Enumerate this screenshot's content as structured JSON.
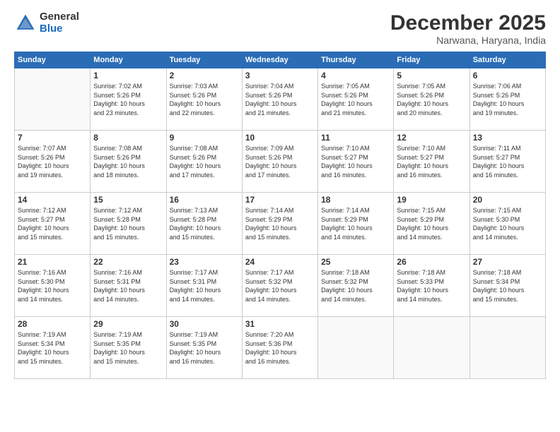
{
  "logo": {
    "general": "General",
    "blue": "Blue"
  },
  "header": {
    "month": "December 2025",
    "location": "Narwana, Haryana, India"
  },
  "weekdays": [
    "Sunday",
    "Monday",
    "Tuesday",
    "Wednesday",
    "Thursday",
    "Friday",
    "Saturday"
  ],
  "weeks": [
    [
      {
        "day": "",
        "info": ""
      },
      {
        "day": "1",
        "info": "Sunrise: 7:02 AM\nSunset: 5:26 PM\nDaylight: 10 hours\nand 23 minutes."
      },
      {
        "day": "2",
        "info": "Sunrise: 7:03 AM\nSunset: 5:26 PM\nDaylight: 10 hours\nand 22 minutes."
      },
      {
        "day": "3",
        "info": "Sunrise: 7:04 AM\nSunset: 5:26 PM\nDaylight: 10 hours\nand 21 minutes."
      },
      {
        "day": "4",
        "info": "Sunrise: 7:05 AM\nSunset: 5:26 PM\nDaylight: 10 hours\nand 21 minutes."
      },
      {
        "day": "5",
        "info": "Sunrise: 7:05 AM\nSunset: 5:26 PM\nDaylight: 10 hours\nand 20 minutes."
      },
      {
        "day": "6",
        "info": "Sunrise: 7:06 AM\nSunset: 5:26 PM\nDaylight: 10 hours\nand 19 minutes."
      }
    ],
    [
      {
        "day": "7",
        "info": "Sunrise: 7:07 AM\nSunset: 5:26 PM\nDaylight: 10 hours\nand 19 minutes."
      },
      {
        "day": "8",
        "info": "Sunrise: 7:08 AM\nSunset: 5:26 PM\nDaylight: 10 hours\nand 18 minutes."
      },
      {
        "day": "9",
        "info": "Sunrise: 7:08 AM\nSunset: 5:26 PM\nDaylight: 10 hours\nand 17 minutes."
      },
      {
        "day": "10",
        "info": "Sunrise: 7:09 AM\nSunset: 5:26 PM\nDaylight: 10 hours\nand 17 minutes."
      },
      {
        "day": "11",
        "info": "Sunrise: 7:10 AM\nSunset: 5:27 PM\nDaylight: 10 hours\nand 16 minutes."
      },
      {
        "day": "12",
        "info": "Sunrise: 7:10 AM\nSunset: 5:27 PM\nDaylight: 10 hours\nand 16 minutes."
      },
      {
        "day": "13",
        "info": "Sunrise: 7:11 AM\nSunset: 5:27 PM\nDaylight: 10 hours\nand 16 minutes."
      }
    ],
    [
      {
        "day": "14",
        "info": "Sunrise: 7:12 AM\nSunset: 5:27 PM\nDaylight: 10 hours\nand 15 minutes."
      },
      {
        "day": "15",
        "info": "Sunrise: 7:12 AM\nSunset: 5:28 PM\nDaylight: 10 hours\nand 15 minutes."
      },
      {
        "day": "16",
        "info": "Sunrise: 7:13 AM\nSunset: 5:28 PM\nDaylight: 10 hours\nand 15 minutes."
      },
      {
        "day": "17",
        "info": "Sunrise: 7:14 AM\nSunset: 5:29 PM\nDaylight: 10 hours\nand 15 minutes."
      },
      {
        "day": "18",
        "info": "Sunrise: 7:14 AM\nSunset: 5:29 PM\nDaylight: 10 hours\nand 14 minutes."
      },
      {
        "day": "19",
        "info": "Sunrise: 7:15 AM\nSunset: 5:29 PM\nDaylight: 10 hours\nand 14 minutes."
      },
      {
        "day": "20",
        "info": "Sunrise: 7:15 AM\nSunset: 5:30 PM\nDaylight: 10 hours\nand 14 minutes."
      }
    ],
    [
      {
        "day": "21",
        "info": "Sunrise: 7:16 AM\nSunset: 5:30 PM\nDaylight: 10 hours\nand 14 minutes."
      },
      {
        "day": "22",
        "info": "Sunrise: 7:16 AM\nSunset: 5:31 PM\nDaylight: 10 hours\nand 14 minutes."
      },
      {
        "day": "23",
        "info": "Sunrise: 7:17 AM\nSunset: 5:31 PM\nDaylight: 10 hours\nand 14 minutes."
      },
      {
        "day": "24",
        "info": "Sunrise: 7:17 AM\nSunset: 5:32 PM\nDaylight: 10 hours\nand 14 minutes."
      },
      {
        "day": "25",
        "info": "Sunrise: 7:18 AM\nSunset: 5:32 PM\nDaylight: 10 hours\nand 14 minutes."
      },
      {
        "day": "26",
        "info": "Sunrise: 7:18 AM\nSunset: 5:33 PM\nDaylight: 10 hours\nand 14 minutes."
      },
      {
        "day": "27",
        "info": "Sunrise: 7:18 AM\nSunset: 5:34 PM\nDaylight: 10 hours\nand 15 minutes."
      }
    ],
    [
      {
        "day": "28",
        "info": "Sunrise: 7:19 AM\nSunset: 5:34 PM\nDaylight: 10 hours\nand 15 minutes."
      },
      {
        "day": "29",
        "info": "Sunrise: 7:19 AM\nSunset: 5:35 PM\nDaylight: 10 hours\nand 15 minutes."
      },
      {
        "day": "30",
        "info": "Sunrise: 7:19 AM\nSunset: 5:35 PM\nDaylight: 10 hours\nand 16 minutes."
      },
      {
        "day": "31",
        "info": "Sunrise: 7:20 AM\nSunset: 5:36 PM\nDaylight: 10 hours\nand 16 minutes."
      },
      {
        "day": "",
        "info": ""
      },
      {
        "day": "",
        "info": ""
      },
      {
        "day": "",
        "info": ""
      }
    ]
  ]
}
